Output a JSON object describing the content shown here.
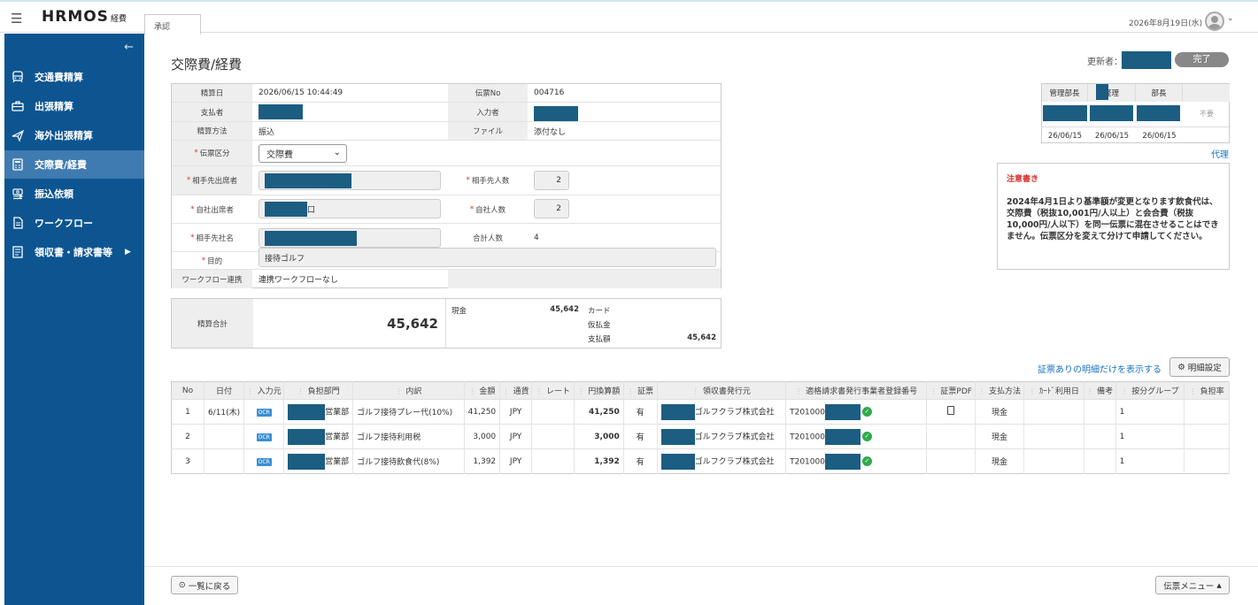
{
  "app": {
    "logo": "HRMOS",
    "logo_sub": "経費",
    "tab": "承認",
    "date": "2026年8月19日(水)"
  },
  "sidebar": {
    "items": [
      {
        "label": "交通費精算",
        "icon": "train-icon"
      },
      {
        "label": "出張精算",
        "icon": "briefcase-icon"
      },
      {
        "label": "海外出張精算",
        "icon": "plane-icon"
      },
      {
        "label": "交際費/経費",
        "icon": "calculator-icon"
      },
      {
        "label": "振込依頼",
        "icon": "transfer-icon"
      },
      {
        "label": "ワークフロー",
        "icon": "document-icon"
      },
      {
        "label": "領収書・請求書等",
        "icon": "receipt-icon"
      }
    ]
  },
  "page": {
    "title": "交際費/経費",
    "updater_label": "更新者：",
    "status": "完了"
  },
  "form": {
    "settle_date_label": "精算日",
    "settle_date": "2026/06/15 10:44:49",
    "slip_no_label": "伝票No",
    "slip_no": "004716",
    "payer_label": "支払者",
    "inputter_label": "入力者",
    "method_label": "精算方法",
    "method": "振込",
    "file_label": "ファイル",
    "file": "添付なし",
    "slip_type_label": "伝票区分",
    "slip_type": "交際費",
    "partner_attendee_label": "相手先出席者",
    "partner_count_label": "相手先人数",
    "partner_count": "2",
    "own_attendee_label": "自社出席者",
    "own_attendee_suffix": "口",
    "own_count_label": "自社人数",
    "own_count": "2",
    "partner_company_label": "相手先社名",
    "total_people_label": "合計人数",
    "total_people": "4",
    "purpose_label": "目的",
    "purpose": "接待ゴルフ",
    "workflow_label": "ワークフロー連携",
    "workflow": "連携ワークフローなし",
    "required_mark": "*"
  },
  "totals": {
    "label": "精算合計",
    "total": "45,642",
    "cash_label": "現金",
    "cash": "45,642",
    "card_label": "カード",
    "advance_label": "仮払金",
    "payment_label": "支払額",
    "payment": "45,642"
  },
  "approval": {
    "heads": [
      "管理部長",
      "経理",
      "部長",
      ""
    ],
    "unneeded": "不要",
    "dates": [
      "26/06/15",
      "26/06/15",
      "26/06/15"
    ],
    "proxy": "代理"
  },
  "notice": {
    "title": "注意書き",
    "body": "2024年4月1日より基準額が変更となります飲食代は、交際費（税抜10,001円/人以上）と会合費（税抜10,000円/人以下）を同一伝票に混在させることはできません。伝票区分を変えて分けて申請してください。"
  },
  "details": {
    "filter_link": "証票ありの明細だけを表示する",
    "settings": "明細設定",
    "headers": [
      "No",
      "日付",
      "入力元",
      "負担部門",
      "内訳",
      "金額",
      "通貨",
      "レート",
      "円換算額",
      "証票",
      "領収書発行元",
      "適格請求書発行事業者登録番号",
      "証票PDF",
      "支払方法",
      "ｶｰﾄﾞ利用日",
      "備考",
      "按分グループ",
      "負担率"
    ],
    "ocr": "OCR",
    "rows": [
      {
        "no": "1",
        "date": "6/11(木)",
        "dept": "営業部",
        "item": "ゴルフ接待プレー代(10%)",
        "amount": "41,250",
        "currency": "JPY",
        "yen": "41,250",
        "receipt": "有",
        "issuer": "ゴルフクラブ株式会社",
        "reg": "T201000",
        "pay": "現金",
        "group": "1"
      },
      {
        "no": "2",
        "date": "",
        "dept": "営業部",
        "item": "ゴルフ接待利用税",
        "amount": "3,000",
        "currency": "JPY",
        "yen": "3,000",
        "receipt": "有",
        "issuer": "ゴルフクラブ株式会社",
        "reg": "T201000",
        "pay": "現金",
        "group": "1"
      },
      {
        "no": "3",
        "date": "",
        "dept": "営業部",
        "item": "ゴルフ接待飲食代(8%)",
        "amount": "1,392",
        "currency": "JPY",
        "yen": "1,392",
        "receipt": "有",
        "issuer": "ゴルフクラブ株式会社",
        "reg": "T201000",
        "pay": "現金",
        "group": "1"
      }
    ]
  },
  "footer": {
    "back": "一覧に戻る",
    "menu": "伝票メニュー"
  },
  "colors": {
    "sidebar": "#0d5591",
    "active": "#3f7bb0",
    "redact": "#1c5d82",
    "link": "#1a73c4",
    "required": "#d9302c"
  }
}
